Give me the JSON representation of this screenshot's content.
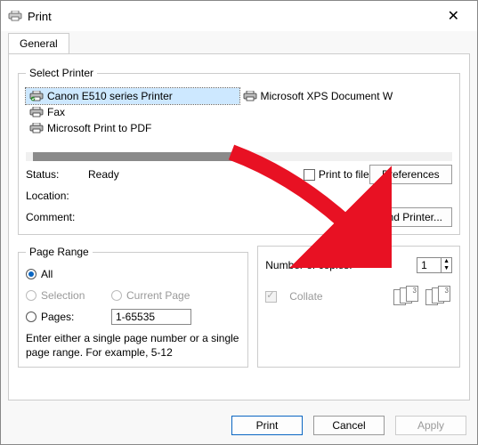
{
  "window": {
    "title": "Print"
  },
  "tabs": {
    "general": "General"
  },
  "select_printer": {
    "legend": "Select Printer",
    "items": [
      {
        "name": "Canon E510 series Printer",
        "selected": true
      },
      {
        "name": "Microsoft XPS Document W",
        "selected": false
      },
      {
        "name": "Fax",
        "selected": false
      },
      {
        "name": "Microsoft Print to PDF",
        "selected": false
      }
    ]
  },
  "status": {
    "status_label": "Status:",
    "status_value": "Ready",
    "location_label": "Location:",
    "location_value": "",
    "comment_label": "Comment:",
    "comment_value": "",
    "print_to_file": "Print to file",
    "preferences": "Preferences",
    "find_printer": "Find Printer..."
  },
  "page_range": {
    "legend": "Page Range",
    "all": "All",
    "selection": "Selection",
    "current_page": "Current Page",
    "pages": "Pages:",
    "pages_value": "1-65535",
    "hint": "Enter either a single page number or a single page range.  For example, 5-12"
  },
  "copies": {
    "label": "Number of copies:",
    "value": "1",
    "collate": "Collate"
  },
  "buttons": {
    "print": "Print",
    "cancel": "Cancel",
    "apply": "Apply"
  }
}
